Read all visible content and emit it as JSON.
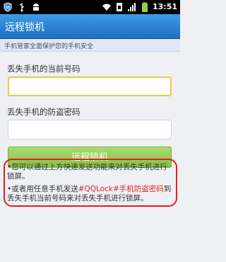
{
  "statusbar": {
    "time": "13:51",
    "icons": [
      "app-shield-icon",
      "usb-icon",
      "android-icon",
      "wifi-icon",
      "sim-icon",
      "signal-icon",
      "battery-icon"
    ]
  },
  "header": {
    "title": "远程锁机",
    "subtitle": "手机管家全面保护您的手机安全"
  },
  "form": {
    "phone_label": "丢失手机的当前号码",
    "phone_value": "",
    "password_label": "丢失手机的防盗密码",
    "password_value": "",
    "submit_label": "远程锁机"
  },
  "tips": {
    "line1": "•您可以通过上方快速发送功能来对丢失手机进行锁屏。",
    "line2_prefix": "•或者用任意手机发送",
    "line2_highlight": "#QQLock#手机防盗密码",
    "line2_suffix": "到丢失手机当前号码来对丢失手机进行锁屏。"
  },
  "colors": {
    "title_bar": "#2a7fd0",
    "button": "#95cc5a",
    "highlight": "#e02525",
    "tip_border": "#e51d1d"
  }
}
